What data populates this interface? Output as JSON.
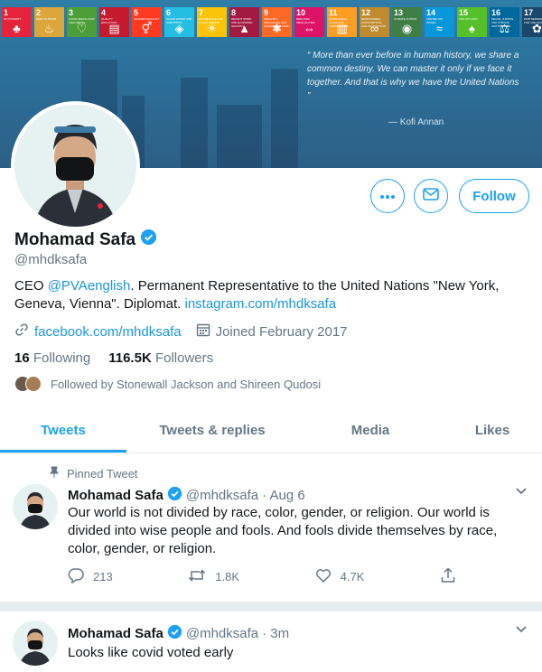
{
  "banner": {
    "sdgs": [
      {
        "num": "1",
        "label": "NO POVERTY",
        "color": "#e5243b",
        "glyph": "♣"
      },
      {
        "num": "2",
        "label": "ZERO HUNGER",
        "color": "#dda63a",
        "glyph": "♨"
      },
      {
        "num": "3",
        "label": "GOOD HEALTH AND WELL-BEING",
        "color": "#4c9f38",
        "glyph": "♡"
      },
      {
        "num": "4",
        "label": "QUALITY EDUCATION",
        "color": "#c5192d",
        "glyph": "▤"
      },
      {
        "num": "5",
        "label": "GENDER EQUALITY",
        "color": "#ff3a21",
        "glyph": "⚥"
      },
      {
        "num": "6",
        "label": "CLEAN WATER AND SANITATION",
        "color": "#26bde2",
        "glyph": "◈"
      },
      {
        "num": "7",
        "label": "AFFORDABLE AND CLEAN ENERGY",
        "color": "#fcc30b",
        "glyph": "☀"
      },
      {
        "num": "8",
        "label": "DECENT WORK AND ECONOMIC GROWTH",
        "color": "#a21942",
        "glyph": "▲"
      },
      {
        "num": "9",
        "label": "INDUSTRY, INNOVATION AND INFRASTRUCTURE",
        "color": "#fd6925",
        "glyph": "✱"
      },
      {
        "num": "10",
        "label": "REDUCED INEQUALITIES",
        "color": "#dd1367",
        "glyph": "⇔"
      },
      {
        "num": "11",
        "label": "SUSTAINABLE CITIES AND COMMUNITIES",
        "color": "#fd9d24",
        "glyph": "▥"
      },
      {
        "num": "12",
        "label": "RESPONSIBLE CONSUMPTION AND PRODUCTION",
        "color": "#bf8b2e",
        "glyph": "∞"
      },
      {
        "num": "13",
        "label": "CLIMATE ACTION",
        "color": "#3f7e44",
        "glyph": "◉"
      },
      {
        "num": "14",
        "label": "LIFE BELOW WATER",
        "color": "#0a97d9",
        "glyph": "≈"
      },
      {
        "num": "15",
        "label": "LIFE ON LAND",
        "color": "#56c02b",
        "glyph": "♠"
      },
      {
        "num": "16",
        "label": "PEACE, JUSTICE AND STRONG INSTITUTIONS",
        "color": "#00689d",
        "glyph": "⚖"
      },
      {
        "num": "17",
        "label": "PARTNERSHIPS FOR THE GOALS",
        "color": "#19486a",
        "glyph": "✿"
      }
    ],
    "quote": "“ More than ever before in human history, we share a common destiny. We can master it only if we face it together. And that is why we have the United Nations ”",
    "quote_author": "— Kofi Annan"
  },
  "profile": {
    "name": "Mohamad Safa",
    "handle": "@mhdksafa",
    "bio_prefix": "CEO ",
    "bio_mention": "@PVAenglish",
    "bio_middle": ". Permanent Representative to the United Nations \"New York, Geneva, Vienna\". Diplomat. ",
    "bio_link": "instagram.com/mhdksafa",
    "website": "facebook.com/mhdksafa",
    "joined": "Joined February 2017",
    "following_count": "16",
    "following_label": "Following",
    "followers_count": "116.5K",
    "followers_label": "Followers",
    "followed_by": "Followed by Stonewall Jackson and Shireen Qudosi",
    "follow_label": "Follow"
  },
  "tabs": [
    {
      "label": "Tweets",
      "active": true
    },
    {
      "label": "Tweets & replies",
      "active": false
    },
    {
      "label": "Media",
      "active": false
    },
    {
      "label": "Likes",
      "active": false
    }
  ],
  "tweets": [
    {
      "pinned_label": "Pinned Tweet",
      "name": "Mohamad Safa",
      "handle": "@mhdksafa",
      "time": "· Aug 6",
      "text": "Our world is not divided by race, color, gender, or religion. Our world is divided into wise people and fools. And fools divide themselves by race, color, gender, or religion.",
      "replies": "213",
      "retweets": "1.8K",
      "likes": "4.7K"
    },
    {
      "name": "Mohamad Safa",
      "handle": "@mhdksafa",
      "time": "· 3m",
      "text": "Looks like covid voted early"
    }
  ],
  "colors": {
    "accent": "#1da1f2",
    "text": "#14171a",
    "muted": "#657786",
    "border": "#e6ecf0"
  },
  "icons": [
    "more-icon",
    "message-icon",
    "verified-icon",
    "link-icon",
    "calendar-icon",
    "pin-icon",
    "chevron-down-icon",
    "reply-icon",
    "retweet-icon",
    "like-icon",
    "share-icon"
  ]
}
